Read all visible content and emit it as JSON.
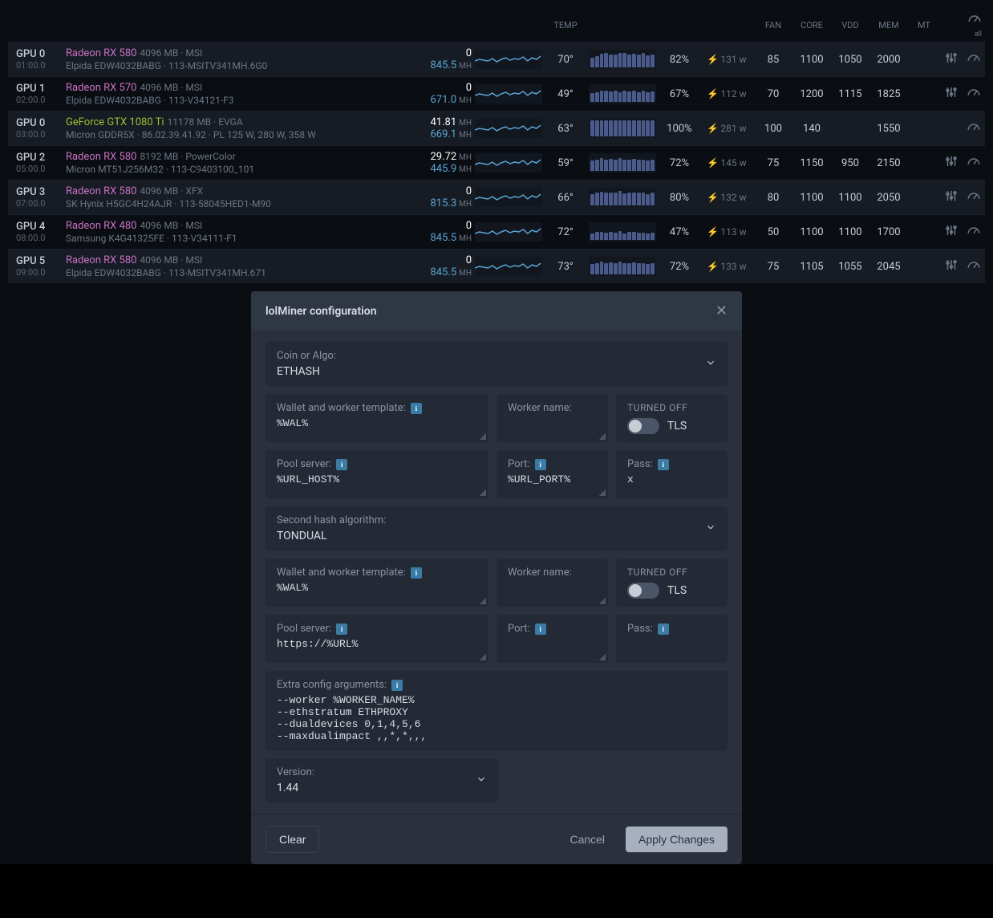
{
  "headers": {
    "temp": "TEMP",
    "fan": "FAN",
    "core": "CORE",
    "vdd": "VDD",
    "mem": "MEM",
    "mt": "MT",
    "all": "all"
  },
  "gpus": [
    {
      "id": "GPU 0",
      "bus": "01:00.0",
      "model": "Radeon RX 580",
      "vendor": "amd",
      "meta": "4096 MB · MSI",
      "chip": "Elpida EDW4032BABG · 113-MSITV341MH.6G0",
      "h1": "0",
      "u1": "",
      "h2": "845.5",
      "u2": "MH",
      "temp": "70°",
      "load": "82%",
      "pow": "131 w",
      "fan": "85",
      "core": "1100",
      "vdd": "1050",
      "mem": "2000",
      "mt": "",
      "tune": true,
      "bars": [
        60,
        70,
        85,
        90,
        82,
        78,
        88,
        92,
        80,
        85,
        82,
        90,
        75,
        82
      ]
    },
    {
      "id": "GPU 1",
      "bus": "02:00.0",
      "model": "Radeon RX 570",
      "vendor": "amd",
      "meta": "4096 MB · MSI",
      "chip": "Elpida EDW4032BABG · 113-V34121-F3",
      "h1": "0",
      "u1": "",
      "h2": "671.0",
      "u2": "MH",
      "temp": "49°",
      "load": "67%",
      "pow": "112 w",
      "fan": "70",
      "core": "1200",
      "vdd": "1115",
      "mem": "1825",
      "mt": "",
      "tune": true,
      "bars": [
        55,
        62,
        70,
        68,
        65,
        72,
        60,
        68,
        65,
        70,
        62,
        68,
        58,
        67
      ]
    },
    {
      "id": "GPU 0",
      "bus": "03:00.0",
      "model": "GeForce GTX 1080 Ti",
      "vendor": "nv",
      "meta": "11178 MB · EVGA",
      "chip": "Micron GDDR5X · 86.02.39.41.92 · PL 125 W, 280 W, 358 W",
      "h1": "41.81",
      "u1": "MH",
      "h2": "669.1",
      "u2": "MH",
      "temp": "63°",
      "load": "100%",
      "pow": "281 w",
      "fan": "100",
      "core": "140",
      "vdd": "",
      "mem": "1550",
      "mt": "",
      "tune": false,
      "bars": [
        98,
        100,
        100,
        99,
        100,
        100,
        100,
        100,
        99,
        100,
        100,
        100,
        100,
        100
      ]
    },
    {
      "id": "GPU 2",
      "bus": "05:00.0",
      "model": "Radeon RX 580",
      "vendor": "amd",
      "meta": "8192 MB · PowerColor",
      "chip": "Micron MT51J256M32 · 113-C9403100_101",
      "h1": "29.72",
      "u1": "MH",
      "h2": "445.9",
      "u2": "MH",
      "temp": "59°",
      "load": "72%",
      "pow": "145 w",
      "fan": "75",
      "core": "1150",
      "vdd": "950",
      "mem": "2150",
      "mt": "",
      "tune": true,
      "bars": [
        65,
        72,
        78,
        70,
        75,
        72,
        80,
        68,
        72,
        75,
        70,
        72,
        65,
        72
      ]
    },
    {
      "id": "GPU 3",
      "bus": "07:00.0",
      "model": "Radeon RX 580",
      "vendor": "amd",
      "meta": "4096 MB · XFX",
      "chip": "SK Hynix H5GC4H24AJR · 113-58045HED1-M90",
      "h1": "0",
      "u1": "",
      "h2": "815.3",
      "u2": "MH",
      "temp": "66°",
      "load": "80%",
      "pow": "132 w",
      "fan": "80",
      "core": "1100",
      "vdd": "1100",
      "mem": "2050",
      "mt": "",
      "tune": true,
      "bars": [
        72,
        80,
        85,
        78,
        82,
        80,
        88,
        75,
        80,
        82,
        78,
        80,
        72,
        80
      ]
    },
    {
      "id": "GPU 4",
      "bus": "08:00.0",
      "model": "Radeon RX 480",
      "vendor": "amd",
      "meta": "4096 MB · MSI",
      "chip": "Samsung K4G41325FE · 113-V34111-F1",
      "h1": "0",
      "u1": "",
      "h2": "845.5",
      "u2": "MH",
      "temp": "72°",
      "load": "47%",
      "pow": "113 w",
      "fan": "50",
      "core": "1100",
      "vdd": "1100",
      "mem": "1700",
      "mt": "",
      "tune": true,
      "bars": [
        40,
        48,
        52,
        45,
        50,
        47,
        55,
        42,
        48,
        50,
        45,
        47,
        40,
        47
      ]
    },
    {
      "id": "GPU 5",
      "bus": "09:00.0",
      "model": "Radeon RX 580",
      "vendor": "amd",
      "meta": "4096 MB · MSI",
      "chip": "Elpida EDW4032BABG · 113-MSITV341MH.671",
      "h1": "0",
      "u1": "",
      "h2": "845.5",
      "u2": "MH",
      "temp": "73°",
      "load": "72%",
      "pow": "133 w",
      "fan": "75",
      "core": "1105",
      "vdd": "1055",
      "mem": "2045",
      "mt": "",
      "tune": true,
      "bars": [
        65,
        72,
        78,
        70,
        75,
        72,
        80,
        68,
        72,
        75,
        70,
        72,
        65,
        72
      ]
    }
  ],
  "dialog": {
    "title": "lolMiner configuration",
    "coin_lbl": "Coin or Algo:",
    "coin_val": "ETHASH",
    "wwt_lbl": "Wallet and worker template:",
    "wwt_val1": "%WAL%",
    "wn_lbl": "Worker name:",
    "wn_val1": "",
    "tls_off": "TURNED OFF",
    "tls_lbl": "TLS",
    "pool_lbl": "Pool server:",
    "pool_val1": "%URL_HOST%",
    "port_lbl": "Port:",
    "port_val1": "%URL_PORT%",
    "pass_lbl": "Pass:",
    "pass_val1": "x",
    "algo2_lbl": "Second hash algorithm:",
    "algo2_val": "TONDUAL",
    "wwt_val2": "%WAL%",
    "wn_val2": "",
    "pool_val2": "https://%URL%",
    "port_val2": "",
    "pass_val2": "",
    "extra_lbl": "Extra config arguments:",
    "extra_val": "--worker %WORKER_NAME%\n--ethstratum ETHPROXY\n--dualdevices 0,1,4,5,6\n--maxdualimpact ,,*,*,,,",
    "version_lbl": "Version:",
    "version_val": "1.44",
    "btn_clear": "Clear",
    "btn_cancel": "Cancel",
    "btn_apply": "Apply Changes"
  }
}
